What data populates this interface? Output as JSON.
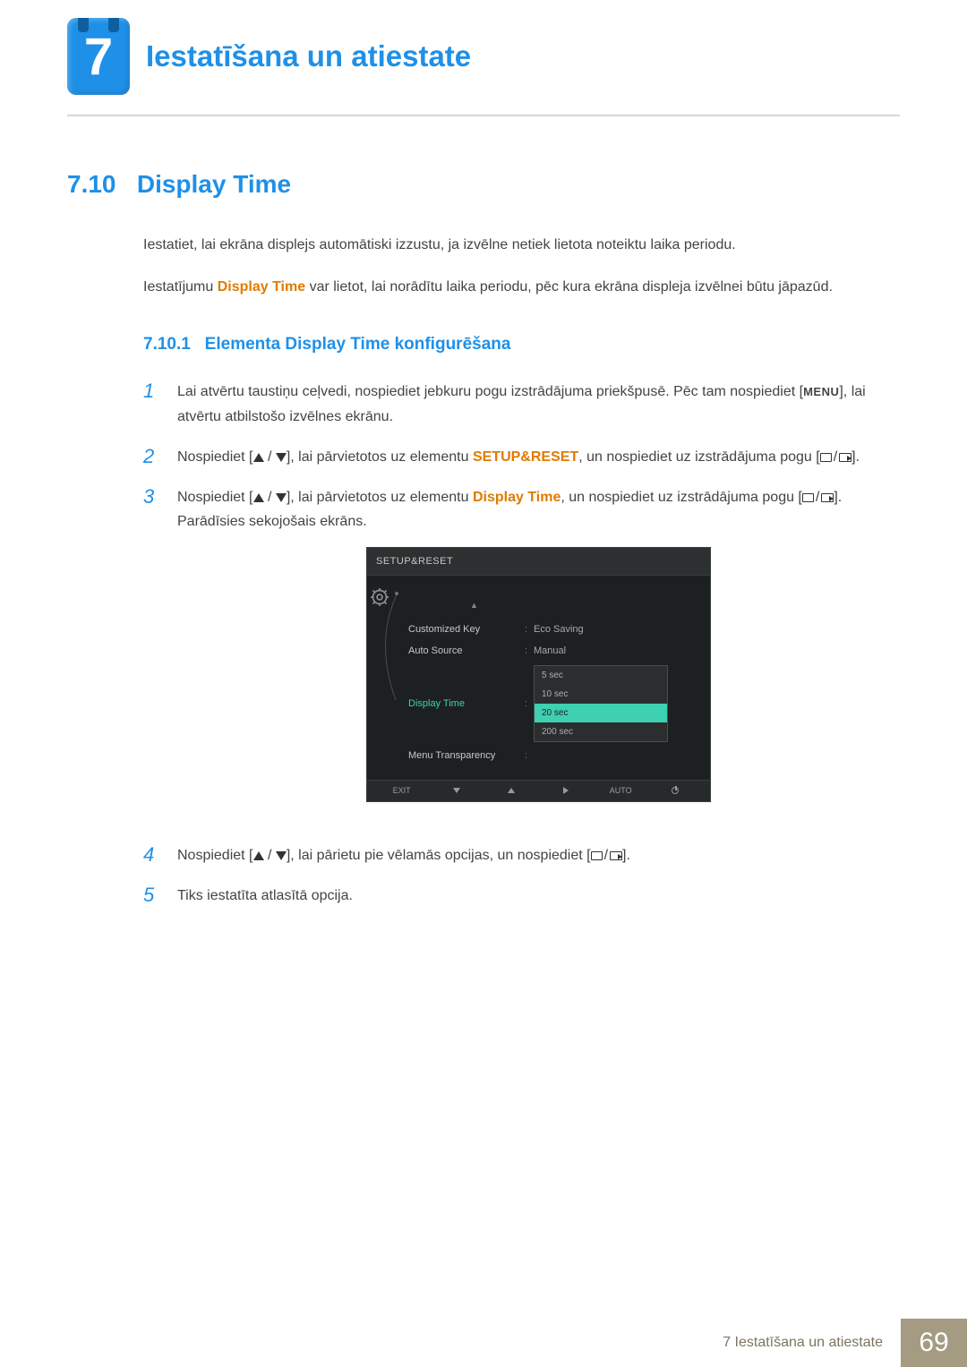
{
  "chapter": {
    "number": "7",
    "title": "Iestatīšana un atiestate"
  },
  "section": {
    "number": "7.10",
    "title": "Display Time"
  },
  "intro1": "Iestatiet, lai ekrāna displejs automātiski izzustu, ja izvēlne netiek lietota noteiktu laika periodu.",
  "intro2_a": "Iestatījumu ",
  "intro2_hl": "Display Time",
  "intro2_b": " var lietot, lai norādītu laika periodu, pēc kura ekrāna displeja izvēlnei būtu jāpazūd.",
  "sub": {
    "number": "7.10.1",
    "title": "Elementa Display Time konfigurēšana"
  },
  "steps": {
    "s1_a": "Lai atvērtu taustiņu ceļvedi, nospiediet jebkuru pogu izstrādājuma priekšpusē. Pēc tam nospiediet [",
    "s1_menu": "MENU",
    "s1_b": "], lai atvērtu atbilstošo izvēlnes ekrānu.",
    "s2_a": "Nospiediet [",
    "s2_b": "], lai pārvietotos uz elementu ",
    "s2_hl": "SETUP&RESET",
    "s2_c": ", un nospiediet uz izstrādājuma pogu [",
    "s2_d": "].",
    "s3_a": "Nospiediet [",
    "s3_b": "], lai pārvietotos uz elementu ",
    "s3_hl": "Display Time",
    "s3_c": ", un nospiediet uz izstrādājuma pogu [",
    "s3_d": "]. Parādīsies sekojošais ekrāns.",
    "s4_a": "Nospiediet [",
    "s4_b": "], lai pārietu pie vēlamās opcijas, un nospiediet [",
    "s4_c": "].",
    "s5": "Tiks iestatīta atlasītā opcija."
  },
  "osd": {
    "title": "SETUP&RESET",
    "rows": [
      {
        "label": "Customized Key",
        "value": "Eco Saving"
      },
      {
        "label": "Auto Source",
        "value": "Manual"
      },
      {
        "label": "Display Time",
        "value": ""
      },
      {
        "label": "Menu Transparency",
        "value": ""
      }
    ],
    "options": [
      "5 sec",
      "10 sec",
      "20 sec",
      "200 sec"
    ],
    "selected_option": "20 sec",
    "footer": {
      "exit": "EXIT",
      "auto": "AUTO"
    }
  },
  "footer": {
    "label": "7 Iestatīšana un atiestate",
    "page": "69"
  }
}
